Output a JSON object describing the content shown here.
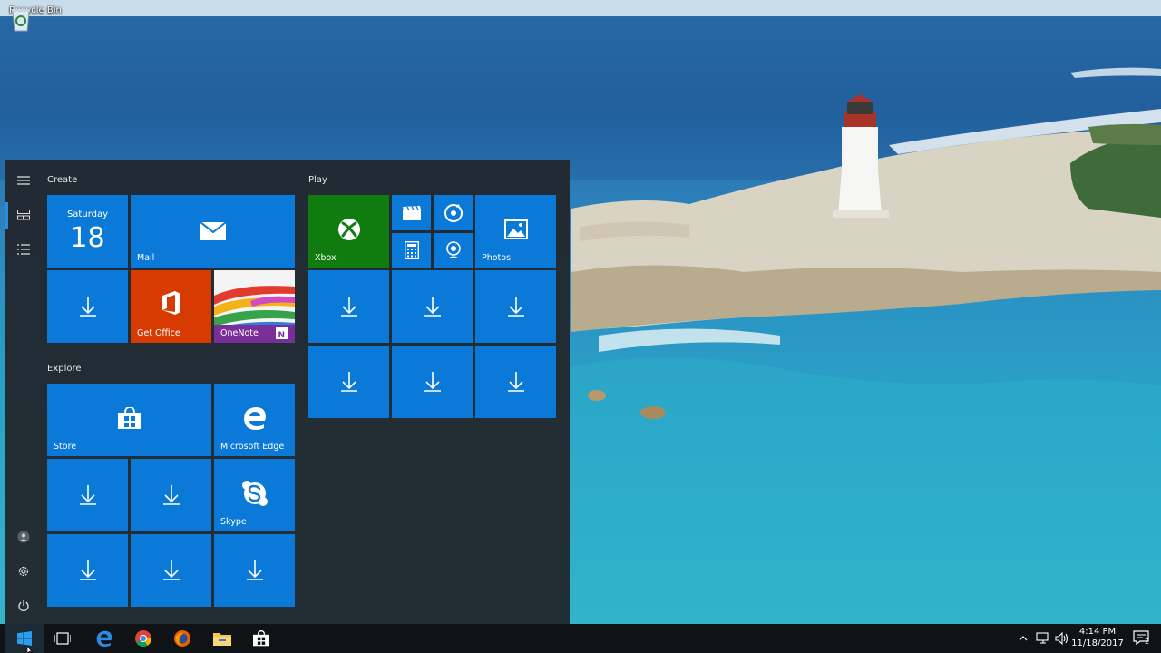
{
  "desktop": {
    "recycle_bin_label": "Recycle Bin"
  },
  "start_menu": {
    "groups": {
      "create": "Create",
      "play": "Play",
      "explore": "Explore"
    },
    "calendar": {
      "day_name": "Saturday",
      "day_number": "18"
    },
    "tiles": {
      "mail": "Mail",
      "get_office": "Get Office",
      "onenote": "OneNote",
      "xbox": "Xbox",
      "photos": "Photos",
      "store": "Store",
      "edge": "Microsoft Edge",
      "skype": "Skype"
    },
    "rail_icons": [
      "hamburger-icon",
      "tiles-icon",
      "list-icon",
      "user-icon",
      "gear-icon",
      "power-icon"
    ]
  },
  "taskbar": {
    "pinned": [
      "task-view-icon",
      "edge-icon",
      "chrome-icon",
      "firefox-icon",
      "file-explorer-icon",
      "store-icon"
    ],
    "clock_time": "4:14 PM",
    "clock_date": "11/18/2017",
    "notification_count": "2"
  },
  "colors": {
    "tile_blue": "#0a79d7",
    "office_orange": "#d83b01",
    "xbox_green": "#107c10",
    "start_bg": "#22282e",
    "taskbar_bg": "#0f1316"
  }
}
